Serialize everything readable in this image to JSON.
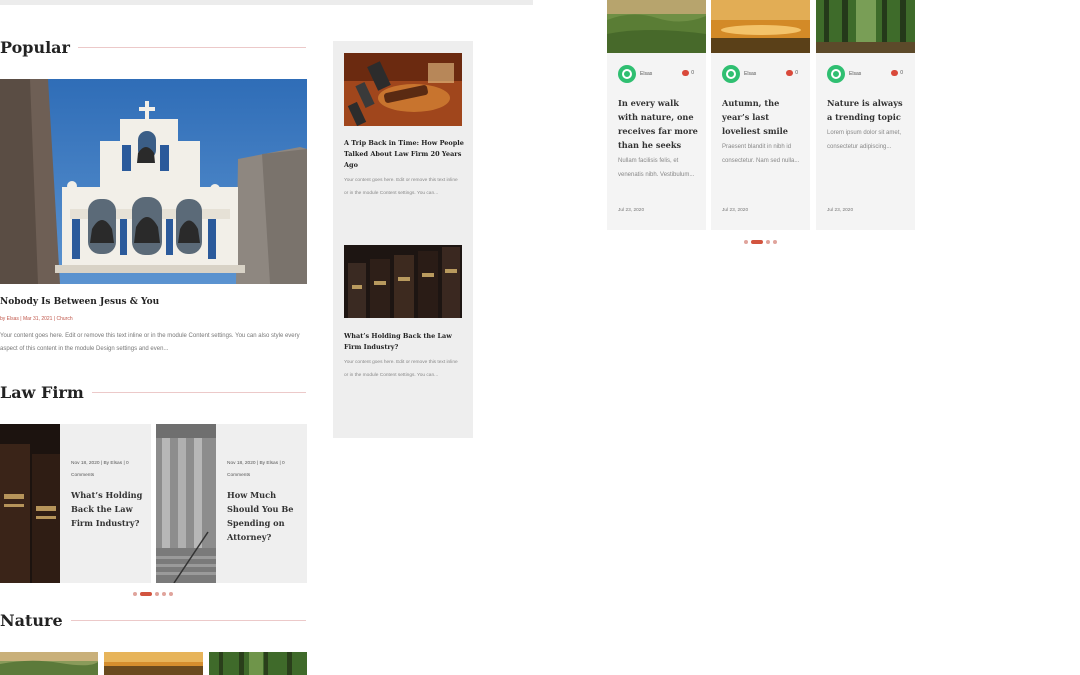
{
  "sections": {
    "popular": "Popular",
    "law_firm": "Law Firm",
    "nature": "Nature"
  },
  "popular_post": {
    "title": "Nobody Is Between Jesus & You",
    "meta": "by Elsas | Mar 31, 2021 | Church",
    "excerpt": "Your content goes here. Edit or remove this text inline or in the module Content settings. You can also style every aspect of this content in the module Design settings and even..."
  },
  "sidebar_posts": [
    {
      "title": "A Trip Back in Time: How People Talked About Law Firm 20 Years Ago",
      "excerpt": "Your content goes here. Edit or remove this text inline or in the module Content settings. You can..."
    },
    {
      "title": "What’s Holding Back the Law Firm Industry?",
      "excerpt": "Your content goes here. Edit or remove this text inline or in the module Content settings. You can..."
    }
  ],
  "law_posts": [
    {
      "meta": "Nov 18, 2020 | By Elsas | 0 Comments",
      "title": "What’s Holding Back the Law Firm Industry?"
    },
    {
      "meta": "Nov 18, 2020 | By Elsas | 0 Comments",
      "title": "How Much Should You Be Spending on Attorney?"
    }
  ],
  "nature_cards": [
    {
      "author": "Elsas",
      "comments": "0",
      "title": "In every walk with nature, one receives far more than he seeks",
      "excerpt": "Nullam facilisis felis, et venenatis nibh. Vestibulum...",
      "date": "Jul 23, 2020"
    },
    {
      "author": "Elsas",
      "comments": "0",
      "title": "Autumn, the year’s last loveliest smile",
      "excerpt": "Praesent blandit in nibh id consectetur. Nam sed nulla...",
      "date": "Jul 23, 2020"
    },
    {
      "author": "Elsas",
      "comments": "0",
      "title": "Nature is always a trending topic",
      "excerpt": "Lorem ipsum dolor sit amet, consectetur adipiscing...",
      "date": "Jul 23, 2020"
    }
  ],
  "colors": {
    "accent": "#d2543f",
    "rule": "#ecc9c9",
    "avatar": "#2fbf71"
  }
}
